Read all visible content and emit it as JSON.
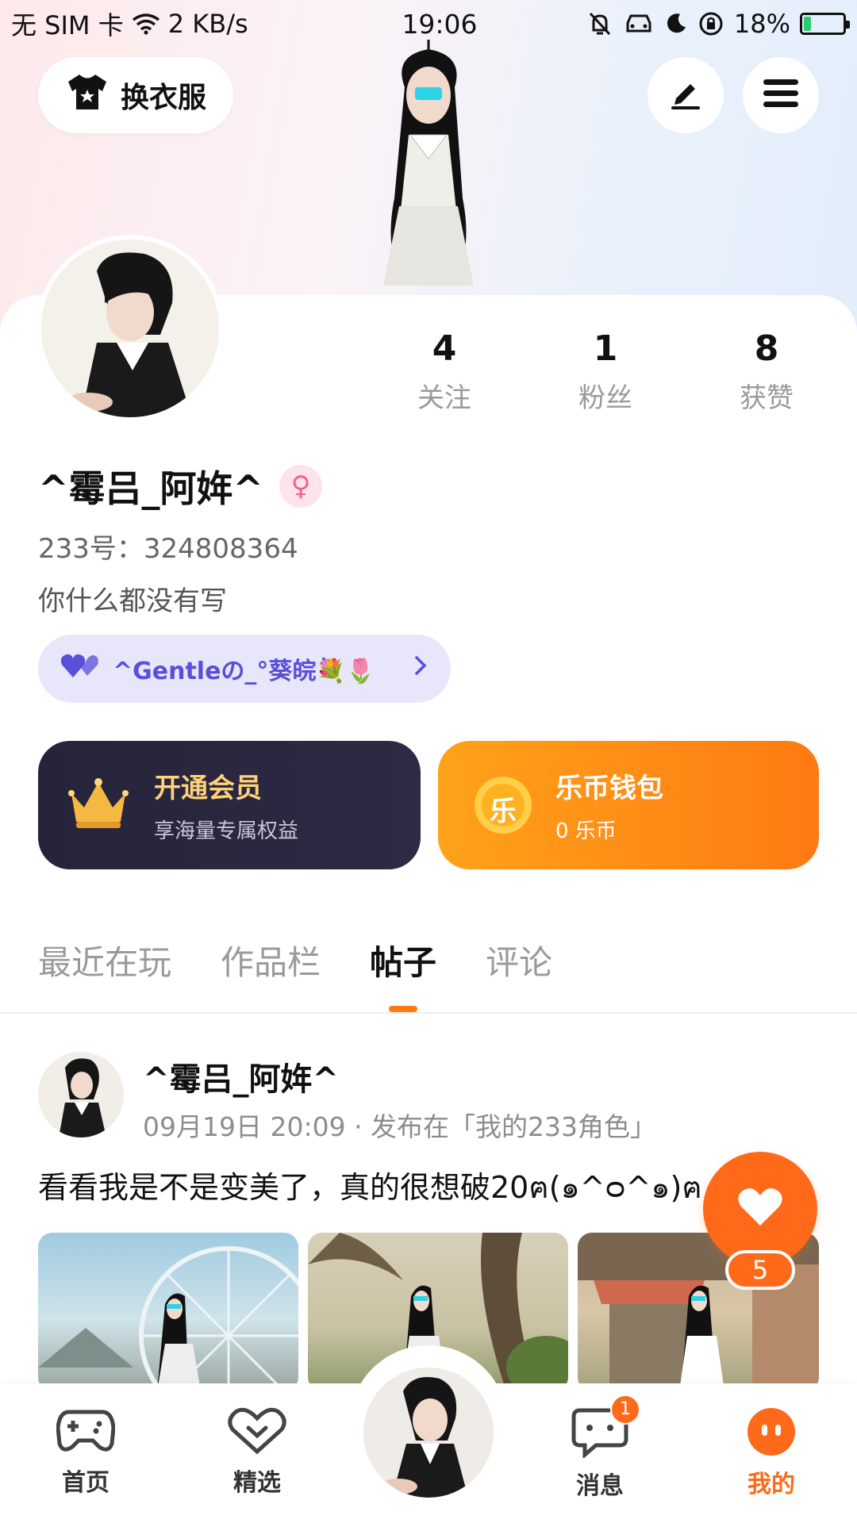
{
  "status_bar": {
    "carrier": "无 SIM 卡",
    "network_speed": "2 KB/s",
    "time": "19:06",
    "battery_percent": "18%",
    "battery_level": 0.18
  },
  "header": {
    "outfit_button_label": "换衣服"
  },
  "profile": {
    "stats": [
      {
        "count": "4",
        "label": "关注"
      },
      {
        "count": "1",
        "label": "粉丝"
      },
      {
        "count": "8",
        "label": "获赞"
      }
    ],
    "nickname": "^霉吕_阿姩^",
    "uid": "233号：324808364",
    "bio": "你什么都没有写",
    "friend_pill_text": "^Gentleの_°葵皖💐🌷"
  },
  "cards": {
    "vip": {
      "title": "开通会员",
      "subtitle": "享海量专属权益"
    },
    "wallet": {
      "icon_text": "乐",
      "title": "乐币钱包",
      "subtitle": "0 乐币"
    }
  },
  "tabs": [
    {
      "label": "最近在玩",
      "active": false
    },
    {
      "label": "作品栏",
      "active": false
    },
    {
      "label": "帖子",
      "active": true
    },
    {
      "label": "评论",
      "active": false
    }
  ],
  "post": {
    "author": "^霉吕_阿姩^",
    "meta": "09月19日 20:09 · 发布在「我的233角色」",
    "text": "看看我是不是变美了，真的很想破20ฅ(๑^ᴑ^๑)ฅ",
    "like_count": "5"
  },
  "bottom_nav": [
    {
      "label": "首页",
      "icon": "gamepad-icon"
    },
    {
      "label": "精选",
      "icon": "heart-chat-icon"
    },
    {
      "label": "消息",
      "icon": "message-icon",
      "badge": "1"
    },
    {
      "label": "我的",
      "icon": "me-icon",
      "active": true
    }
  ],
  "colors": {
    "accent": "#ff6a1a",
    "vip_card": "#26243a",
    "wallet_card": "#ff8a14",
    "friend_pill": "#e8e6fb",
    "friend_text": "#5a4fd8"
  }
}
